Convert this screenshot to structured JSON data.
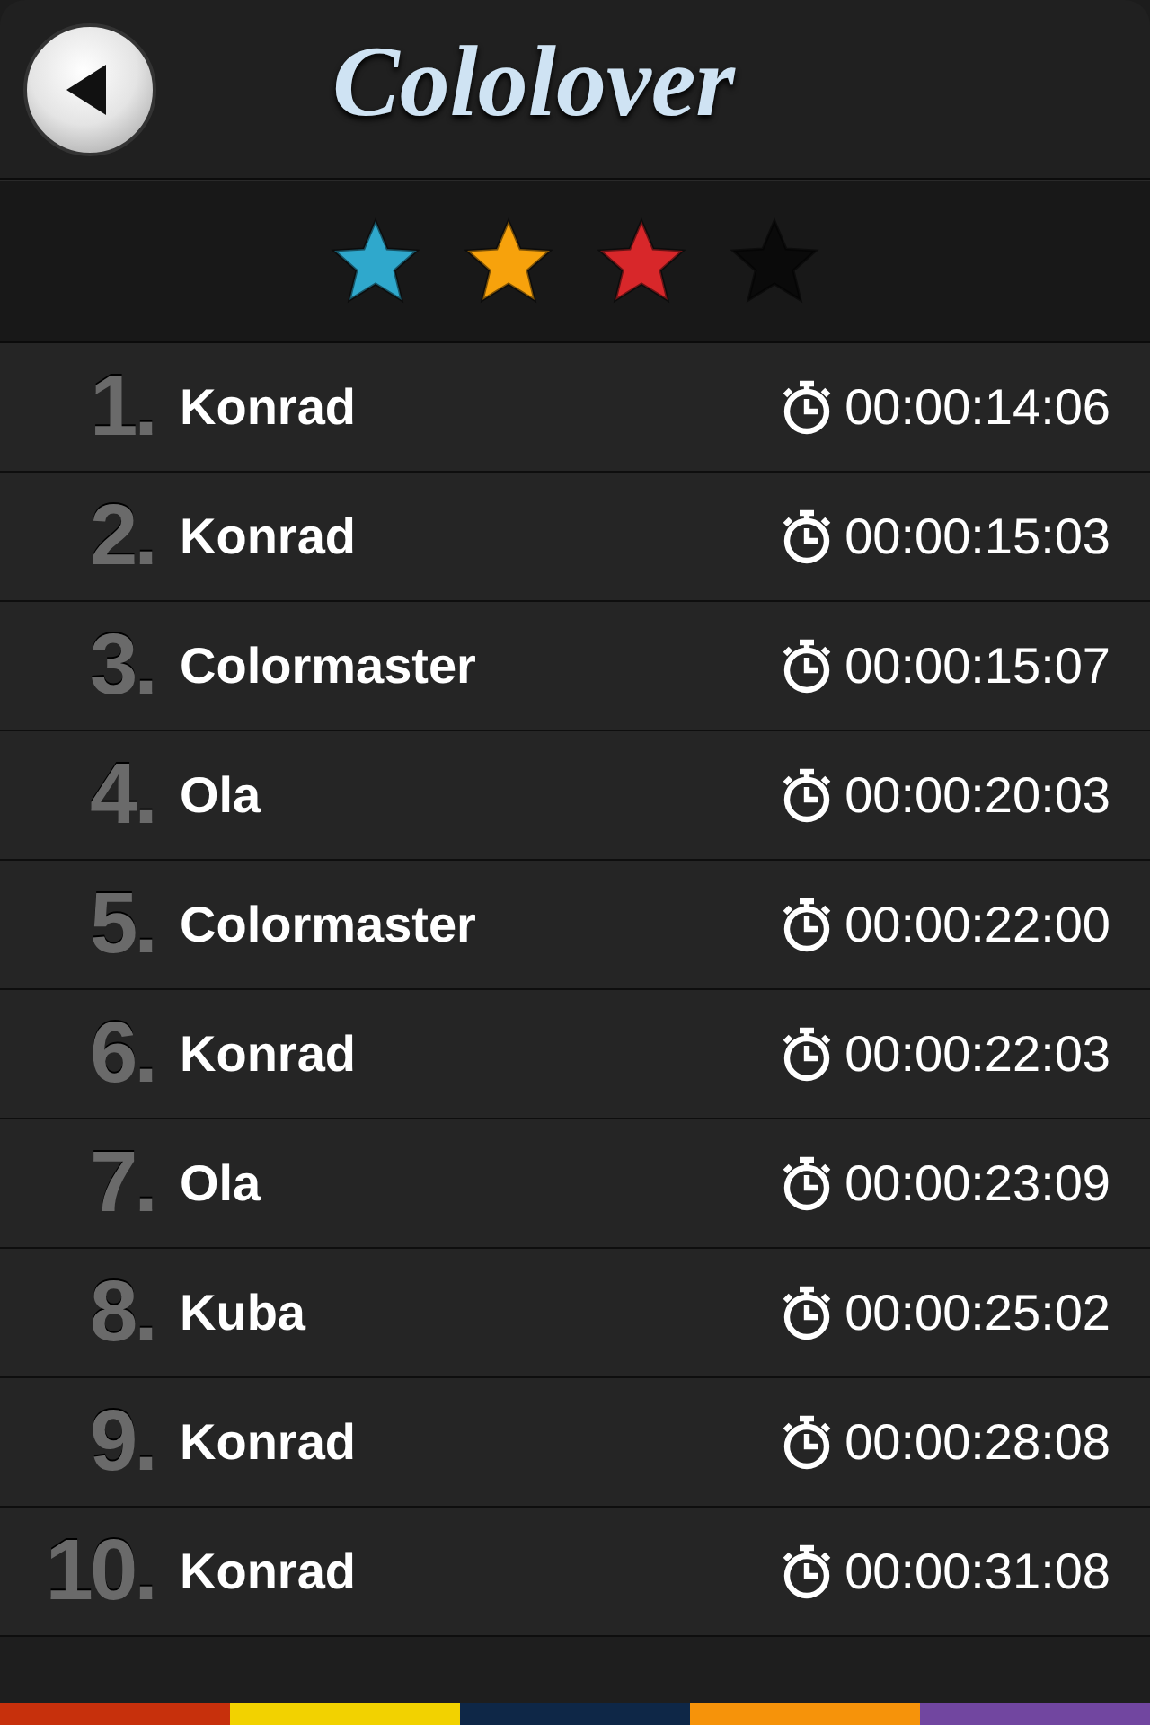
{
  "header": {
    "title": "Cololover"
  },
  "stars": [
    {
      "color": "#2fa8cc"
    },
    {
      "color": "#f7a20c"
    },
    {
      "color": "#d8272a"
    },
    {
      "color": "#0a0a0a"
    }
  ],
  "scores": [
    {
      "rank": "1.",
      "name": "Konrad",
      "time": "00:00:14:06"
    },
    {
      "rank": "2.",
      "name": "Konrad",
      "time": "00:00:15:03"
    },
    {
      "rank": "3.",
      "name": "Colormaster",
      "time": "00:00:15:07"
    },
    {
      "rank": "4.",
      "name": "Ola",
      "time": "00:00:20:03"
    },
    {
      "rank": "5.",
      "name": "Colormaster",
      "time": "00:00:22:00"
    },
    {
      "rank": "6.",
      "name": "Konrad",
      "time": "00:00:22:03"
    },
    {
      "rank": "7.",
      "name": "Ola",
      "time": "00:00:23:09"
    },
    {
      "rank": "8.",
      "name": "Kuba",
      "time": "00:00:25:02"
    },
    {
      "rank": "9.",
      "name": "Konrad",
      "time": "00:00:28:08"
    },
    {
      "rank": "10.",
      "name": "Konrad",
      "time": "00:00:31:08"
    }
  ],
  "color_stripe": [
    {
      "color": "#c7300c"
    },
    {
      "color": "#f2d200"
    },
    {
      "color": "#0e2747"
    },
    {
      "color": "#f6930a"
    },
    {
      "color": "#7146a0"
    }
  ]
}
